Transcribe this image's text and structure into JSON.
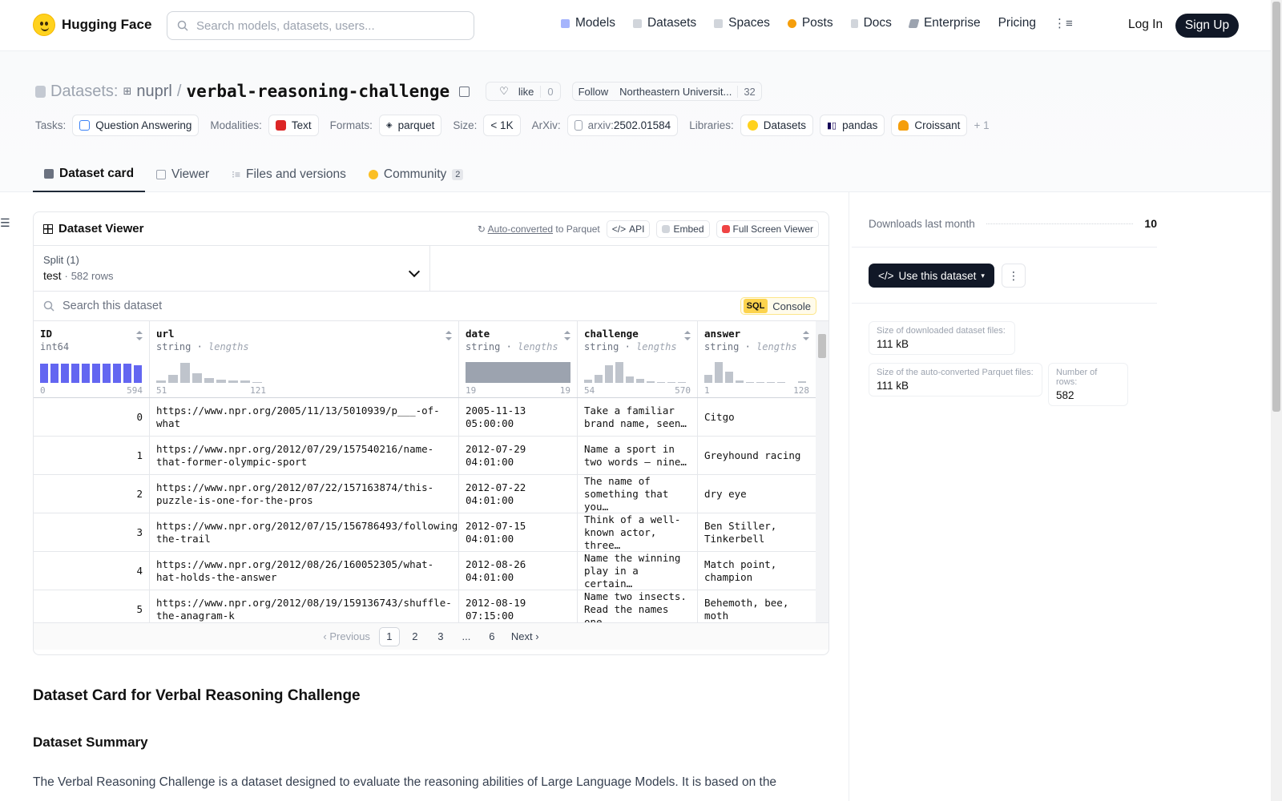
{
  "brand": {
    "name": "Hugging Face"
  },
  "nav": {
    "search_placeholder": "Search models, datasets, users...",
    "links": [
      {
        "label": "Models",
        "icon": "models-icon",
        "color": "#a5b4fc"
      },
      {
        "label": "Datasets",
        "icon": "datasets-icon",
        "color": "#d1d5db"
      },
      {
        "label": "Spaces",
        "icon": "spaces-icon",
        "color": "#d1d5db"
      },
      {
        "label": "Posts",
        "icon": "posts-icon",
        "color": "#f59e0b"
      },
      {
        "label": "Docs",
        "icon": "docs-icon",
        "color": "#d1d5db"
      },
      {
        "label": "Enterprise",
        "icon": "enterprise-icon",
        "color": "#9ca3af"
      },
      {
        "label": "Pricing"
      }
    ],
    "login": "Log In",
    "signup": "Sign Up"
  },
  "header": {
    "crumb": "Datasets:",
    "owner": "nuprl",
    "sep": "/",
    "name": "verbal-reasoning-challenge",
    "like_label": "like",
    "like_count": "0",
    "follow_label": "Follow",
    "org": "Northeastern Universit...",
    "follow_count": "32",
    "tags": {
      "tasks_label": "Tasks:",
      "task": "Question Answering",
      "modalities_label": "Modalities:",
      "modality": "Text",
      "formats_label": "Formats:",
      "format": "parquet",
      "size_label": "Size:",
      "size": "< 1K",
      "arxiv_label": "ArXiv:",
      "arxiv_prefix": "arxiv:",
      "arxiv_id": "2502.01584",
      "libraries_label": "Libraries:",
      "lib1": "Datasets",
      "lib2": "pandas",
      "lib3": "Croissant",
      "more": "+ 1"
    },
    "tabs": [
      {
        "label": "Dataset card"
      },
      {
        "label": "Viewer"
      },
      {
        "label": "Files and versions"
      },
      {
        "label": "Community",
        "badge": "2"
      }
    ]
  },
  "viewer": {
    "title": "Dataset Viewer",
    "auto_link": "Auto-converted",
    "auto_suffix": " to Parquet",
    "api": "API",
    "embed": "Embed",
    "fullscreen": "Full Screen Viewer",
    "split_label": "Split (1)",
    "split_value": "test",
    "split_dot": "·",
    "split_rows": "582 rows",
    "search_placeholder": "Search this dataset",
    "sql": "SQL",
    "console": "Console",
    "columns": [
      {
        "name": "ID",
        "type": "int64",
        "sub": "",
        "min": "0",
        "max": "594"
      },
      {
        "name": "url",
        "type": "string",
        "sub": "lengths",
        "min": "51",
        "max": "121"
      },
      {
        "name": "date",
        "type": "string",
        "sub": "lengths",
        "min": "19",
        "max": "19"
      },
      {
        "name": "challenge",
        "type": "string",
        "sub": "lengths",
        "min": "54",
        "max": "570"
      },
      {
        "name": "answer",
        "type": "string",
        "sub": "lengths",
        "min": "1",
        "max": "128"
      }
    ],
    "rows": [
      {
        "id": "0",
        "url": "https://www.npr.org/2005/11/13/5010939/p___-of-what",
        "date": "2005-11-13 05:00:00",
        "challenge": "Take a familiar brand name, seen…",
        "answer": "Citgo"
      },
      {
        "id": "1",
        "url": "https://www.npr.org/2012/07/29/157540216/name-that-former-olympic-sport",
        "date": "2012-07-29 04:01:00",
        "challenge": "Name a sport in two words — nine…",
        "answer": "Greyhound racing"
      },
      {
        "id": "2",
        "url": "https://www.npr.org/2012/07/22/157163874/this-puzzle-is-one-for-the-pros",
        "date": "2012-07-22 04:01:00",
        "challenge": "The name of something that you…",
        "answer": "dry eye"
      },
      {
        "id": "3",
        "url": "https://www.npr.org/2012/07/15/156786493/following-the-trail",
        "date": "2012-07-15 04:01:00",
        "challenge": "Think of a well-known actor, three…",
        "answer": "Ben Stiller, Tinkerbell"
      },
      {
        "id": "4",
        "url": "https://www.npr.org/2012/08/26/160052305/what-hat-holds-the-answer",
        "date": "2012-08-26 04:01:00",
        "challenge": "Name the winning play in a certain…",
        "answer": "Match point, champion"
      },
      {
        "id": "5",
        "url": "https://www.npr.org/2012/08/19/159136743/shuffle-the-anagram-k",
        "date": "2012-08-19 07:15:00",
        "challenge": "Name two insects. Read the names one…",
        "answer": "Behemoth, bee, moth"
      }
    ],
    "pager": {
      "prev": "Previous",
      "pages": [
        "1",
        "2",
        "3",
        "...",
        "6"
      ],
      "next": "Next"
    }
  },
  "card": {
    "h2": "Dataset Card for Verbal Reasoning Challenge",
    "h3": "Dataset Summary",
    "p": "The Verbal Reasoning Challenge is a dataset designed to evaluate the reasoning abilities of Large Language Models. It is based on the"
  },
  "sidebar": {
    "downloads_label": "Downloads last month",
    "downloads_value": "10",
    "use_button": "Use this dataset",
    "dl_size_label": "Size of downloaded dataset files:",
    "dl_size_value": "111 kB",
    "pq_size_label": "Size of the auto-converted Parquet files:",
    "pq_size_value": "111 kB",
    "rows_label": "Number of rows:",
    "rows_value": "582"
  }
}
